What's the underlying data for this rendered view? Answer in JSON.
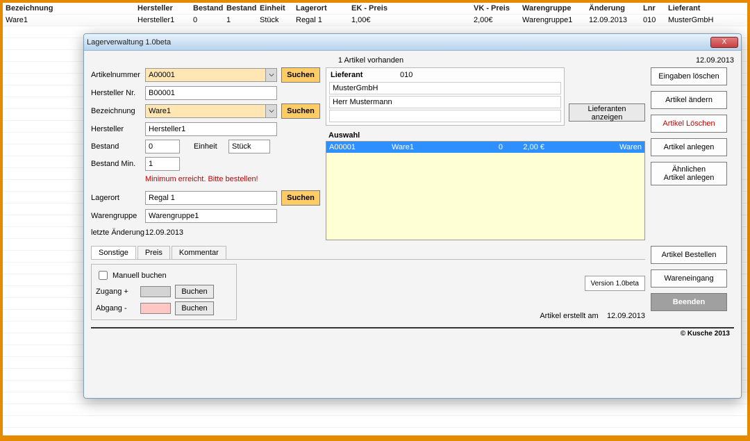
{
  "sheet": {
    "headers": [
      "Bezeichnung",
      "Hersteller",
      "Bestand",
      "Bestand",
      "Einheit",
      "Lagerort",
      "EK - Preis",
      "VK - Preis",
      "Warengruppe",
      "Änderung",
      "Lnr",
      "Lieferant"
    ],
    "widths": [
      190,
      80,
      48,
      48,
      52,
      80,
      176,
      70,
      96,
      78,
      36,
      100
    ],
    "row": [
      "Ware1",
      "Hersteller1",
      "0",
      "1",
      "Stück",
      "Regal 1",
      "1,00€",
      "2,00€",
      "Warengruppe1",
      "12.09.2013",
      "010",
      "MusterGmbH"
    ]
  },
  "dialog": {
    "title": "Lagerverwaltung 1.0beta",
    "count_text": "1 Artikel vorhanden",
    "date": "12.09.2013",
    "labels": {
      "artikelnummer": "Artikelnummer",
      "hersteller_nr": "Hersteller Nr.",
      "bezeichnung": "Bezeichnung",
      "hersteller": "Hersteller",
      "bestand": "Bestand",
      "einheit": "Einheit",
      "bestand_min": "Bestand Min.",
      "lagerort": "Lagerort",
      "warengruppe": "Warengruppe",
      "letzte_aenderung": "letzte Änderung",
      "lieferant": "Lieferant",
      "auswahl": "Auswahl",
      "manuell": "Manuell buchen",
      "zugang": "Zugang +",
      "abgang": "Abgang -",
      "erstellt": "Artikel erstellt am"
    },
    "values": {
      "artikelnummer": "A00001",
      "hersteller_nr": "B00001",
      "bezeichnung": "Ware1",
      "hersteller": "Hersteller1",
      "bestand": "0",
      "einheit": "Stück",
      "bestand_min": "1",
      "warn": "Minimum erreicht. Bitte bestellen!",
      "lagerort": "Regal 1",
      "warengruppe": "Warengruppe1",
      "letzte_aenderung": "12.09.2013",
      "lieferant_code": "010",
      "lieferant_name": "MusterGmbH",
      "lieferant_contact": "Herr Mustermann",
      "erstellt_am": "12.09.2013",
      "version": "Version 1.0beta"
    },
    "selection": {
      "c1": "A00001",
      "c2": "Ware1",
      "c3": "0",
      "c4": "2,00 €",
      "c5": "Waren"
    },
    "buttons": {
      "suchen": "Suchen",
      "lieferanten_anzeigen": "Lieferanten anzeigen",
      "eingaben_loeschen": "Eingaben löschen",
      "artikel_aendern": "Artikel ändern",
      "artikel_loeschen": "Artikel Löschen",
      "artikel_anlegen": "Artikel anlegen",
      "aehnlichen": "Ähnlichen\nArtikel anlegen",
      "artikel_bestellen": "Artikel Bestellen",
      "wareneingang": "Wareneingang",
      "beenden": "Beenden",
      "buchen": "Buchen",
      "close": "X"
    },
    "tabs": [
      "Sonstige",
      "Preis",
      "Kommentar"
    ],
    "copyright": "© Kusche 2013"
  }
}
